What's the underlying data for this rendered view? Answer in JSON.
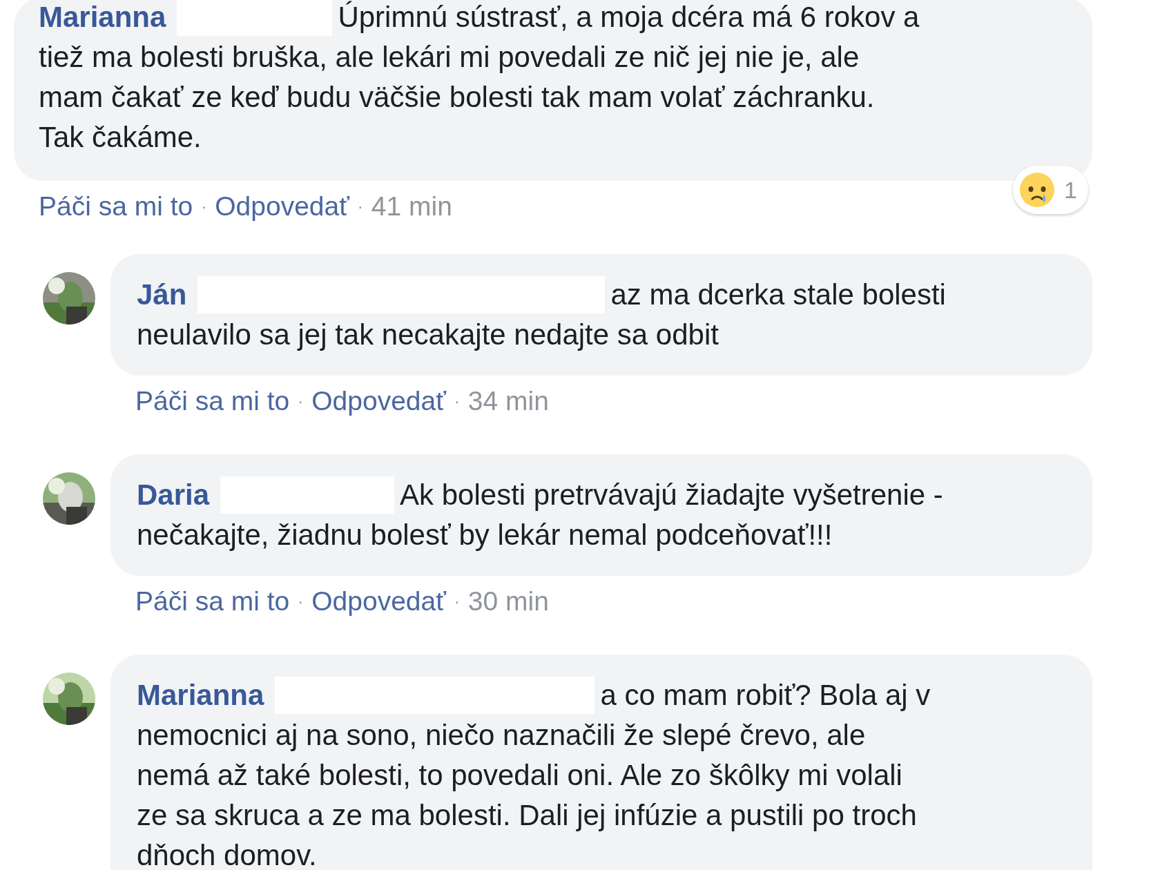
{
  "comments": [
    {
      "author": "Marianna",
      "surname_hidden": true,
      "reply": false,
      "lines": [
        "Úprimnú sústrasť, a moja dcéra má 6 rokov a",
        "tiež ma bolesti bruška, ale lekári mi povedali ze nič jej nie je, ale",
        "mam čakať ze keď budu väčšie bolesti tak mam volať záchranku.",
        "Tak čakáme."
      ],
      "reaction": {
        "count": "1"
      },
      "actions": {
        "like": "Páči sa mi to",
        "separator": "·",
        "reply": "Odpovedať",
        "time": "41 min"
      }
    },
    {
      "author": "Ján",
      "surname_hidden": true,
      "reply": true,
      "lines": [
        "az ma dcerka stale bolesti",
        "neulavilo sa jej tak necakajte nedajte sa odbit"
      ],
      "actions": {
        "like": "Páči sa mi to",
        "separator": "·",
        "reply": "Odpovedať",
        "time": "34 min"
      }
    },
    {
      "author": "Daria",
      "surname_hidden": true,
      "reply": true,
      "lines": [
        "Ak bolesti pretrvávajú žiadajte vyšetrenie -",
        "nečakajte, žiadnu bolesť by lekár nemal podceňovať!!!"
      ],
      "actions": {
        "like": "Páči sa mi to",
        "separator": "·",
        "reply": "Odpovedať",
        "time": "30 min"
      }
    },
    {
      "author": "Marianna",
      "surname_hidden": true,
      "reply": true,
      "lines": [
        "a co mam robiť? Bola aj v",
        "nemocnici aj na sono, niečo naznačili že slepé črevo, ale",
        "nemá až také bolesti, to povedali oni. Ale zo škôlky mi volali",
        "ze sa skruca a ze ma bolesti. Dali jej infúzie a pustili po troch",
        "dňoch domov."
      ]
    }
  ]
}
